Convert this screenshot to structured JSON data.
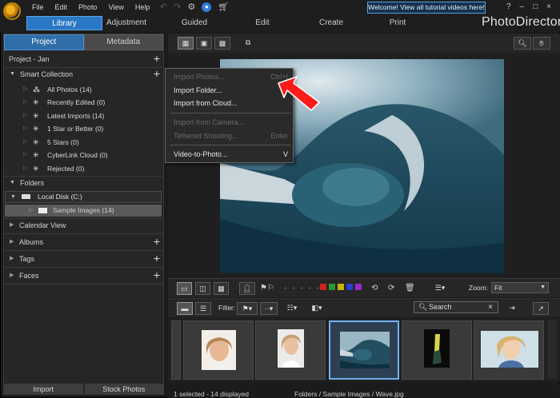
{
  "menu": [
    "File",
    "Edit",
    "Photo",
    "View",
    "Help"
  ],
  "welcome_banner": "Welcome! View all tutorial videos here!",
  "window_controls": [
    "?",
    "–",
    "□",
    "×"
  ],
  "modes": [
    "Library",
    "Adjustment",
    "Guided",
    "Edit",
    "Create",
    "Print"
  ],
  "active_mode": "Library",
  "brand": "PhotoDirector",
  "panel_tabs": [
    "Project",
    "Metadata"
  ],
  "active_panel_tab": "Project",
  "project_name": "Project - Jan",
  "smart_collection": {
    "title": "Smart Collection",
    "items": [
      {
        "icon": "all-photos-icon",
        "label": "All Photos (14)"
      },
      {
        "icon": "recently-edited-icon",
        "label": "Recently Edited (0)"
      },
      {
        "icon": "latest-imports-icon",
        "label": "Latest Imports (14)"
      },
      {
        "icon": "star-icon",
        "label": "1 Star or Better (0)"
      },
      {
        "icon": "star-icon",
        "label": "5 Stars (0)"
      },
      {
        "icon": "cloud-icon",
        "label": "CyberLink Cloud (0)"
      },
      {
        "icon": "rejected-icon",
        "label": "Rejected (0)"
      }
    ]
  },
  "folders": {
    "title": "Folders",
    "disk": "Local Disk (C:)",
    "subfolder": "Sample Images (14)"
  },
  "sections": [
    "Calendar View",
    "Albums",
    "Tags",
    "Faces"
  ],
  "bottom_buttons": [
    "Import",
    "Stock Photos"
  ],
  "import_menu": {
    "items": [
      {
        "label": "Import Photos...",
        "shortcut": "Ctrl+I",
        "enabled": false
      },
      {
        "label": "Import Folder...",
        "shortcut": "",
        "enabled": true
      },
      {
        "label": "Import from Cloud...",
        "shortcut": "",
        "enabled": true
      },
      {
        "label": "Import from Camera...",
        "shortcut": "",
        "enabled": false
      },
      {
        "label": "Tethered Shooting...",
        "shortcut": "Enter",
        "enabled": false
      },
      {
        "label": "Video-to-Photo...",
        "shortcut": "V",
        "enabled": true
      }
    ]
  },
  "color_labels": [
    "#d42020",
    "#2a9a2a",
    "#c8b400",
    "#2840c8",
    "#9a28c8"
  ],
  "zoom": {
    "label": "Zoom:",
    "value": "Fit"
  },
  "filter_label": "Filter:",
  "search_placeholder": "Search",
  "status": {
    "selection": "1 selected - 14 displayed",
    "path": "Folders / Sample Images / Wave.jpg"
  }
}
